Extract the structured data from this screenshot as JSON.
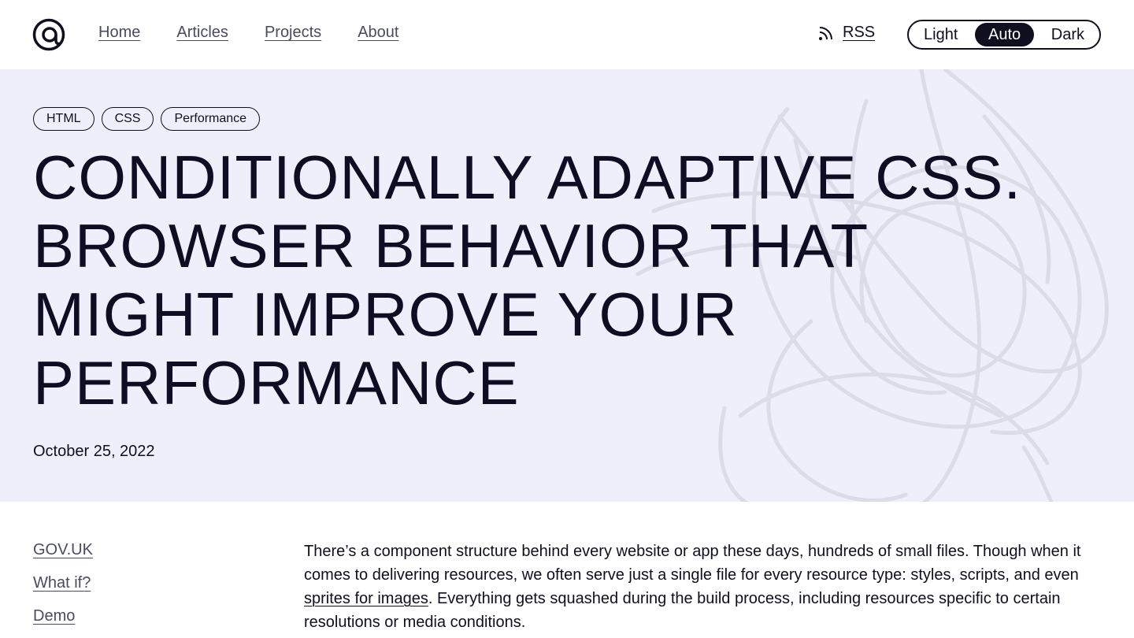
{
  "nav": {
    "items": [
      "Home",
      "Articles",
      "Projects",
      "About"
    ],
    "rss_label": "RSS"
  },
  "theme": {
    "options": [
      "Light",
      "Auto",
      "Dark"
    ],
    "selected": "Auto"
  },
  "hero": {
    "tags": [
      "HTML",
      "CSS",
      "Performance"
    ],
    "title_lines": [
      "CONDITIONALLY ADAPTIVE CSS.",
      "BROWSER BEHAVIOR THAT",
      "MIGHT IMPROVE YOUR",
      "PERFORMANCE"
    ],
    "date": "October 25, 2022"
  },
  "toc": {
    "items": [
      "GOV.UK",
      "What if?",
      "Demo"
    ]
  },
  "article": {
    "p1_before": "There’s a component structure behind every website or app these days, hundreds of small files. Though when it comes to delivering resources, we often serve just a single file for every resource type: styles, scripts, and even ",
    "p1_link": "sprites for images",
    "p1_after": ". Everything gets squashed during the build process, including re­sources specific to certain resolutions or media conditions."
  },
  "colors": {
    "hero_bg": "#efeffc",
    "ink": "#0f0f1f",
    "muted_link": "#4a4b60",
    "scribble": "#dcdce8"
  },
  "icons": [
    "logo-icon",
    "rss-icon"
  ]
}
